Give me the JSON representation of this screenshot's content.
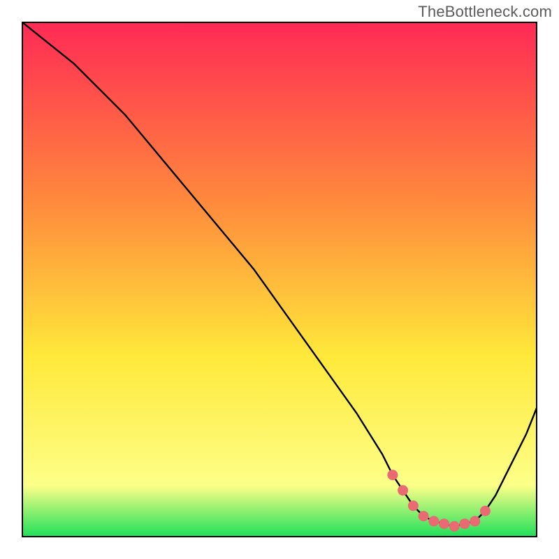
{
  "watermark": "TheBottleneck.com",
  "colors": {
    "gradient_top": "#ff2a55",
    "gradient_mid1": "#ff8a3c",
    "gradient_mid2": "#ffe93a",
    "gradient_mid3": "#fdff88",
    "gradient_bottom": "#1fe05a",
    "curve": "#000000",
    "marker": "#e96a73",
    "frame": "#000000",
    "background": "#ffffff"
  },
  "chart_data": {
    "type": "line",
    "title": "",
    "xlabel": "",
    "ylabel": "",
    "xlim": [
      0,
      100
    ],
    "ylim": [
      0,
      100
    ],
    "series": [
      {
        "name": "bottleneck-curve",
        "x": [
          0,
          5,
          10,
          15,
          20,
          25,
          30,
          35,
          40,
          45,
          50,
          55,
          60,
          65,
          70,
          72,
          74,
          76,
          78,
          80,
          82,
          84,
          86,
          88,
          90,
          92,
          94,
          96,
          98,
          100
        ],
        "values": [
          100,
          96,
          92,
          87,
          82,
          76,
          70,
          64,
          58,
          52,
          45,
          38,
          31,
          24,
          16,
          12,
          9,
          6,
          4,
          3,
          2.5,
          2,
          2.5,
          3,
          5,
          8,
          12,
          16,
          20,
          25
        ]
      }
    ],
    "markers": {
      "name": "highlighted-range",
      "x": [
        72,
        74,
        76,
        78,
        80,
        82,
        84,
        86,
        88,
        90
      ],
      "values": [
        12,
        9,
        6,
        4,
        3,
        2.5,
        2,
        2.5,
        3,
        5
      ]
    }
  }
}
